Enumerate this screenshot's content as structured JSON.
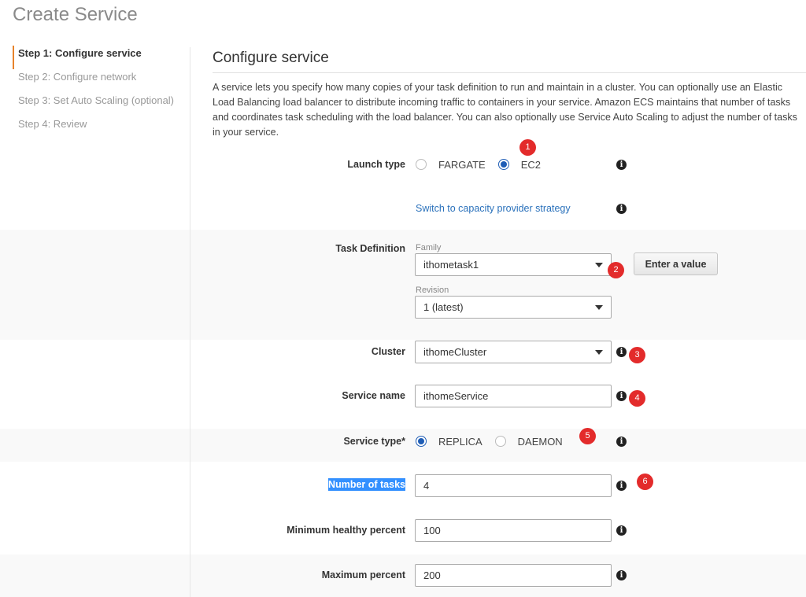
{
  "page_title": "Create Service",
  "steps": [
    {
      "label": "Step 1: Configure service",
      "active": true
    },
    {
      "label": "Step 2: Configure network",
      "active": false
    },
    {
      "label": "Step 3: Set Auto Scaling (optional)",
      "active": false
    },
    {
      "label": "Step 4: Review",
      "active": false
    }
  ],
  "section": {
    "title": "Configure service",
    "description": "A service lets you specify how many copies of your task definition to run and maintain in a cluster. You can optionally use an Elastic Load Balancing load balancer to distribute incoming traffic to containers in your service. Amazon ECS maintains that number of tasks and coordinates task scheduling with the load balancer. You can also optionally use Service Auto Scaling to adjust the number of tasks in your service."
  },
  "form": {
    "launch_type": {
      "label": "Launch type",
      "options": [
        "FARGATE",
        "EC2"
      ],
      "selected": "EC2"
    },
    "capacity_link": "Switch to capacity provider strategy",
    "task_definition": {
      "label": "Task Definition",
      "family_label": "Family",
      "family_value": "ithometask1",
      "enter_value_button": "Enter a value",
      "revision_label": "Revision",
      "revision_value": "1 (latest)"
    },
    "cluster": {
      "label": "Cluster",
      "value": "ithomeCluster"
    },
    "service_name": {
      "label": "Service name",
      "value": "ithomeService"
    },
    "service_type": {
      "label": "Service type*",
      "options": [
        "REPLICA",
        "DAEMON"
      ],
      "selected": "REPLICA"
    },
    "number_of_tasks": {
      "label": "Number of tasks",
      "value": "4"
    },
    "min_healthy_percent": {
      "label": "Minimum healthy percent",
      "value": "100"
    },
    "max_percent": {
      "label": "Maximum percent",
      "value": "200"
    }
  },
  "info_icon_glyph": "i",
  "badges": [
    "1",
    "2",
    "3",
    "4",
    "5",
    "6"
  ],
  "colors": {
    "accent_step": "#e7832b",
    "link": "#2a71bb",
    "radio_selected": "#1f5db5",
    "badge": "#e32b2b",
    "highlight": "#3390ff"
  }
}
